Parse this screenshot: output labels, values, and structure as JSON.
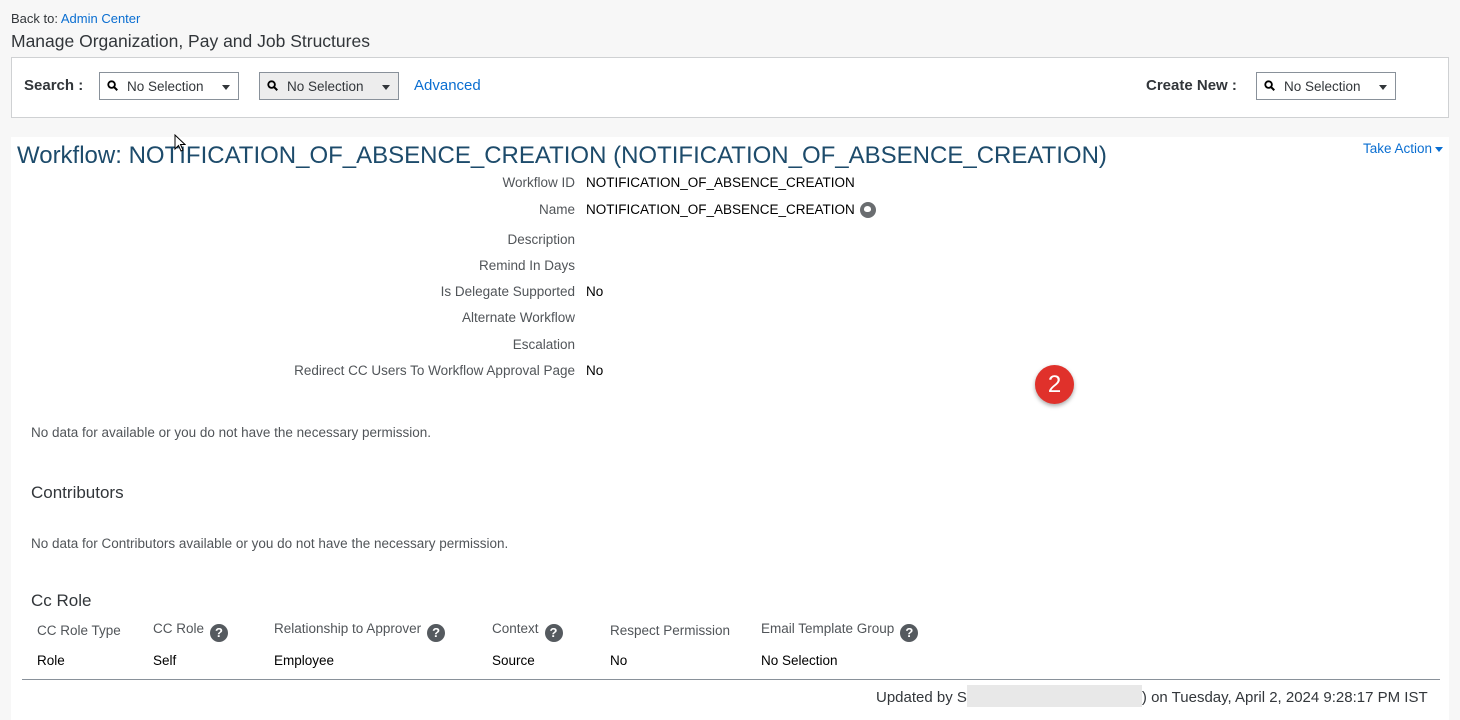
{
  "header": {
    "back_prefix": "Back to:",
    "back_link": "Admin Center",
    "title": "Manage Organization, Pay and Job Structures"
  },
  "search": {
    "label": "Search :",
    "dropdown1": "No Selection",
    "dropdown2": "No Selection",
    "advanced": "Advanced",
    "create_label": "Create New :",
    "create_dropdown": "No Selection"
  },
  "workflow": {
    "title": "Workflow: NOTIFICATION_OF_ABSENCE_CREATION (NOTIFICATION_OF_ABSENCE_CREATION)",
    "take_action": "Take Action",
    "fields": [
      {
        "label": "Workflow ID",
        "value": "NOTIFICATION_OF_ABSENCE_CREATION"
      },
      {
        "label": "Name",
        "value": "NOTIFICATION_OF_ABSENCE_CREATION"
      },
      {
        "label": "Description",
        "value": ""
      },
      {
        "label": "Remind In Days",
        "value": ""
      },
      {
        "label": "Is Delegate Supported",
        "value": "No"
      },
      {
        "label": "Alternate Workflow",
        "value": ""
      },
      {
        "label": "Escalation",
        "value": ""
      },
      {
        "label": "Redirect CC Users To Workflow Approval Page",
        "value": "No"
      }
    ]
  },
  "badge": "2",
  "no_data_1": "No data for available or you do not have the necessary permission.",
  "contributors": {
    "title": "Contributors",
    "no_data": "No data for Contributors available or you do not have the necessary permission."
  },
  "cc_role": {
    "title": "Cc Role",
    "headers": [
      "CC Role Type",
      "CC Role",
      "Relationship to Approver",
      "Context",
      "Respect Permission",
      "Email Template Group"
    ],
    "row": [
      "Role",
      "Self",
      "Employee",
      "Source",
      "No",
      "No Selection"
    ]
  },
  "updated": {
    "prefix": "Updated by S",
    "suffix": ") on Tuesday, April 2, 2024 9:28:17 PM IST"
  },
  "icons": {
    "search": "magnifier-icon",
    "dropdown": "caret-down-icon",
    "translate": "globe-icon",
    "help": "question-icon",
    "cursor": "mouse-pointer-icon"
  },
  "colors": {
    "link": "#0a6ed1",
    "title": "#1d4b6b",
    "badge": "#e0312b"
  }
}
